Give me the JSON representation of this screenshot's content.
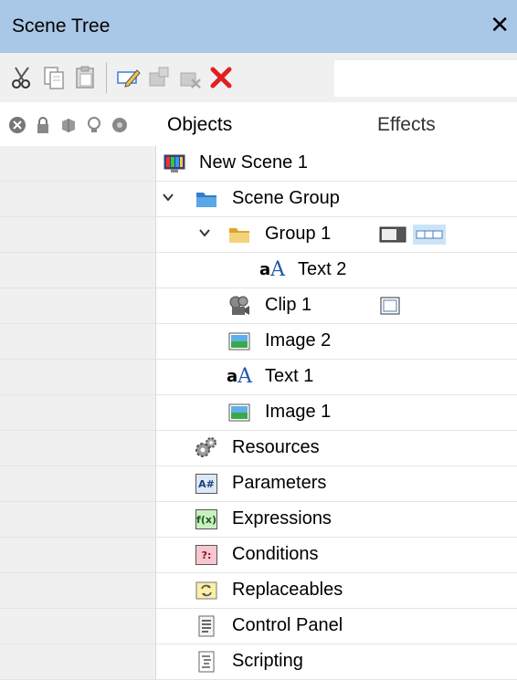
{
  "window": {
    "title": "Scene Tree",
    "close_glyph": "✕"
  },
  "toolbar": {
    "buttons": [
      {
        "icon": "scissors-icon"
      },
      {
        "icon": "copy-icon"
      },
      {
        "icon": "paste-icon"
      },
      {
        "icon": "rename-icon"
      },
      {
        "icon": "add-icon"
      },
      {
        "icon": "remove-icon"
      },
      {
        "icon": "delete-icon"
      }
    ],
    "search_value": ""
  },
  "header": {
    "objects_label": "Objects",
    "effects_label": "Effects",
    "column_icons": [
      "disable-icon",
      "lock-icon",
      "cube-icon",
      "bulb-icon",
      "render-icon"
    ]
  },
  "tree": {
    "rows": [
      {
        "label": "New Scene 1",
        "icon": "scene-icon",
        "expanded": null
      },
      {
        "label": "Scene Group",
        "icon": "folder-blue-icon",
        "expanded": true
      },
      {
        "label": "Group 1",
        "icon": "folder-yellow-icon",
        "expanded": true,
        "effects": [
          "shadow-effect-icon",
          "grid-effect-icon"
        ]
      },
      {
        "label": "Text 2",
        "icon": "text-icon",
        "expanded": null
      },
      {
        "label": "Clip 1",
        "icon": "clip-icon",
        "expanded": null,
        "effects": [
          "crop-effect-icon"
        ]
      },
      {
        "label": "Image 2",
        "icon": "image-icon",
        "expanded": null
      },
      {
        "label": "Text 1",
        "icon": "text-icon",
        "expanded": null
      },
      {
        "label": "Image 1",
        "icon": "image-icon",
        "expanded": null
      },
      {
        "label": "Resources",
        "icon": "gears-icon",
        "expanded": null
      },
      {
        "label": "Parameters",
        "icon": "parameters-icon",
        "expanded": null,
        "badge": "A#"
      },
      {
        "label": "Expressions",
        "icon": "expressions-icon",
        "expanded": null,
        "badge": "f(x)"
      },
      {
        "label": "Conditions",
        "icon": "conditions-icon",
        "expanded": null,
        "badge": "?:"
      },
      {
        "label": "Replaceables",
        "icon": "replaceables-icon",
        "expanded": null
      },
      {
        "label": "Control Panel",
        "icon": "control-panel-icon",
        "expanded": null
      },
      {
        "label": "Scripting",
        "icon": "scripting-icon",
        "expanded": null
      }
    ]
  }
}
